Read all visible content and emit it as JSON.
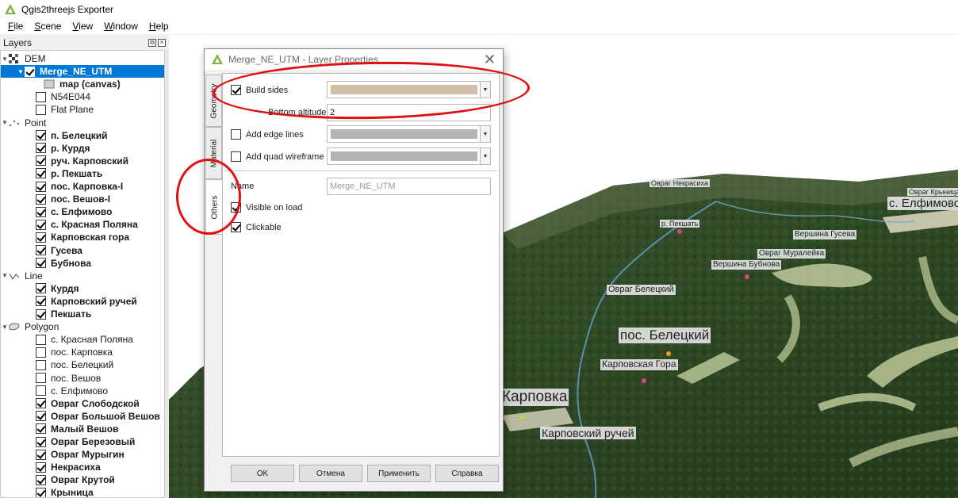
{
  "app": {
    "title": "Qgis2threejs Exporter"
  },
  "menu": [
    {
      "label": "File",
      "u": "F",
      "rest": "ile"
    },
    {
      "label": "Scene",
      "u": "S",
      "rest": "cene"
    },
    {
      "label": "View",
      "u": "V",
      "rest": "iew"
    },
    {
      "label": "Window",
      "u": "W",
      "rest": "indow"
    },
    {
      "label": "Help",
      "u": "H",
      "rest": "elp"
    }
  ],
  "layers_panel": {
    "title": "Layers",
    "groups": {
      "dem": "DEM",
      "point": "Point",
      "line": "Line",
      "polygon": "Polygon"
    },
    "dem_items": [
      "Merge_NE_UTM",
      "map (canvas)",
      "N54E044",
      "Flat Plane"
    ],
    "point_items": [
      "п. Белецкий",
      "р. Курдя",
      "руч. Карповский",
      "р. Пекшать",
      "пос. Карповка-I",
      "пос. Вешов-I",
      "с. Елфимово",
      "с. Красная Поляна",
      "Карповская гора",
      "Гусева",
      "Бубнова"
    ],
    "line_items": [
      "Курдя",
      "Карповский ручей",
      "Пекшать"
    ],
    "polygon_items": [
      "с. Красная Поляна",
      "пос. Карповка",
      "пос. Белецкий",
      "пос. Вешов",
      "с. Елфимово",
      "Овраг Слободской",
      "Овраг Большой Вешов",
      "Малый Вешов",
      "Овраг Березовый",
      "Овраг Мурыгин",
      "Некрасиха",
      "Овраг Крутой",
      "Крыница"
    ]
  },
  "map_labels": [
    "Овраг Некрасиха",
    "Овраг Крыница",
    "с. Елфимово",
    "р. Пекшать",
    "Вершина Гусева",
    "Овраг Муралейка",
    "Вершина Бубнова",
    "Овраг Белецкий",
    "пос. Белецкий",
    "Карповская Гора",
    "Карповка",
    "Карповский ручей"
  ],
  "dialog": {
    "title": "Merge_NE_UTM - Layer Properties",
    "tabs": [
      "Geometry",
      "Material",
      "Others"
    ],
    "build_sides_label": "Build sides",
    "bottom_altitude_label": "Bottom altitude",
    "bottom_altitude_value": "2",
    "add_edge_lines_label": "Add edge lines",
    "add_quad_wireframe_label": "Add quad wireframe",
    "name_label": "Name",
    "name_placeholder": "Merge_NE_UTM",
    "visible_on_load_label": "Visible on load",
    "clickable_label": "Clickable",
    "buttons": {
      "ok": "OK",
      "cancel": "Отмена",
      "apply": "Применить",
      "help": "Справка"
    }
  },
  "colors": {
    "selection": "#0078d7",
    "side_color": "#d2bfa8",
    "disabled_color": "#b4b4b4",
    "annotation": "#e01010"
  }
}
